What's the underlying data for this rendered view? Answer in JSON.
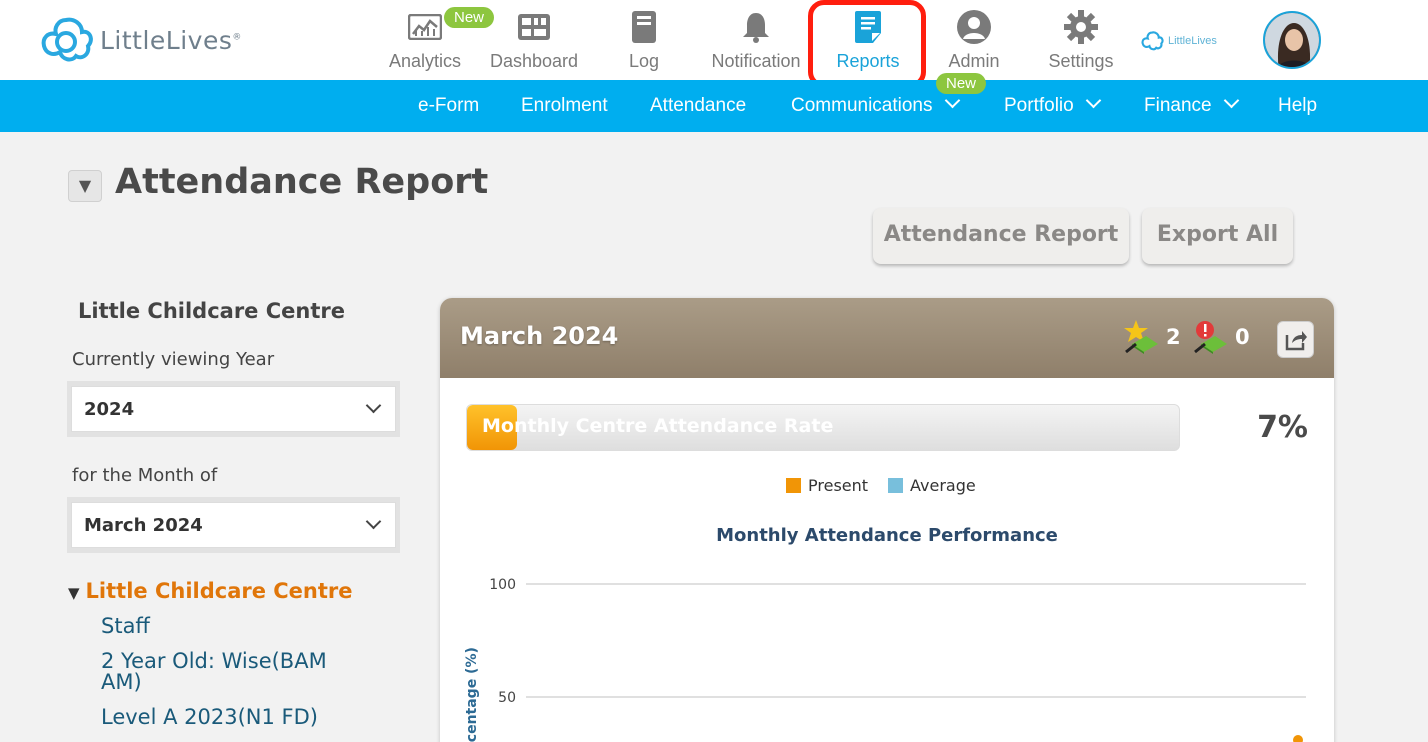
{
  "brand": {
    "name": "LittleLives",
    "mark": "®",
    "mini": "LittleLives"
  },
  "nav": [
    {
      "label": "Analytics",
      "icon": "analytics-icon",
      "badge": "New"
    },
    {
      "label": "Dashboard",
      "icon": "dashboard-icon"
    },
    {
      "label": "Log",
      "icon": "log-icon"
    },
    {
      "label": "Notification",
      "icon": "bell-icon"
    },
    {
      "label": "Reports",
      "icon": "reports-icon",
      "active": true
    },
    {
      "label": "Admin",
      "icon": "user-icon",
      "badge": "New"
    },
    {
      "label": "Settings",
      "icon": "gear-icon"
    }
  ],
  "menu": [
    {
      "label": "e-Form"
    },
    {
      "label": "Enrolment"
    },
    {
      "label": "Attendance"
    },
    {
      "label": "Communications",
      "dropdown": true
    },
    {
      "label": "Portfolio",
      "dropdown": true
    },
    {
      "label": "Finance",
      "dropdown": true
    },
    {
      "label": "Help"
    }
  ],
  "page": {
    "collapse_glyph": "▼",
    "title": "Attendance Report",
    "buttons": {
      "report": "Attendance Report",
      "export": "Export All"
    }
  },
  "filters": {
    "centre": "Little Childcare Centre",
    "year_label": "Currently viewing Year",
    "year_value": "2024",
    "month_label": "for the Month of",
    "month_value": "March 2024"
  },
  "tree": {
    "root": "Little Childcare Centre",
    "root_glyph": "▼",
    "items": [
      "Staff",
      "2 Year Old: Wise(BAM AM)",
      "Level A 2023(N1 FD)"
    ]
  },
  "card": {
    "title": "March 2024",
    "achievements": {
      "stars": "2",
      "alerts": "0"
    },
    "rate_label": "Monthly Centre Attendance Rate",
    "rate_value": "7%",
    "rate_fraction": 0.07
  },
  "colors": {
    "present": "#f19506",
    "average": "#78bfdc",
    "brand": "#00aeef",
    "highlight": "#ff1e0e"
  },
  "chart_data": {
    "type": "line",
    "title": "Monthly Attendance Performance",
    "ylabel": "Percentage (%)",
    "yticks": [
      "100",
      "50"
    ],
    "ylim": [
      0,
      100
    ],
    "legend": "top-center",
    "series": [
      {
        "name": "Present",
        "values": [
          7
        ]
      },
      {
        "name": "Average",
        "values": []
      }
    ]
  }
}
